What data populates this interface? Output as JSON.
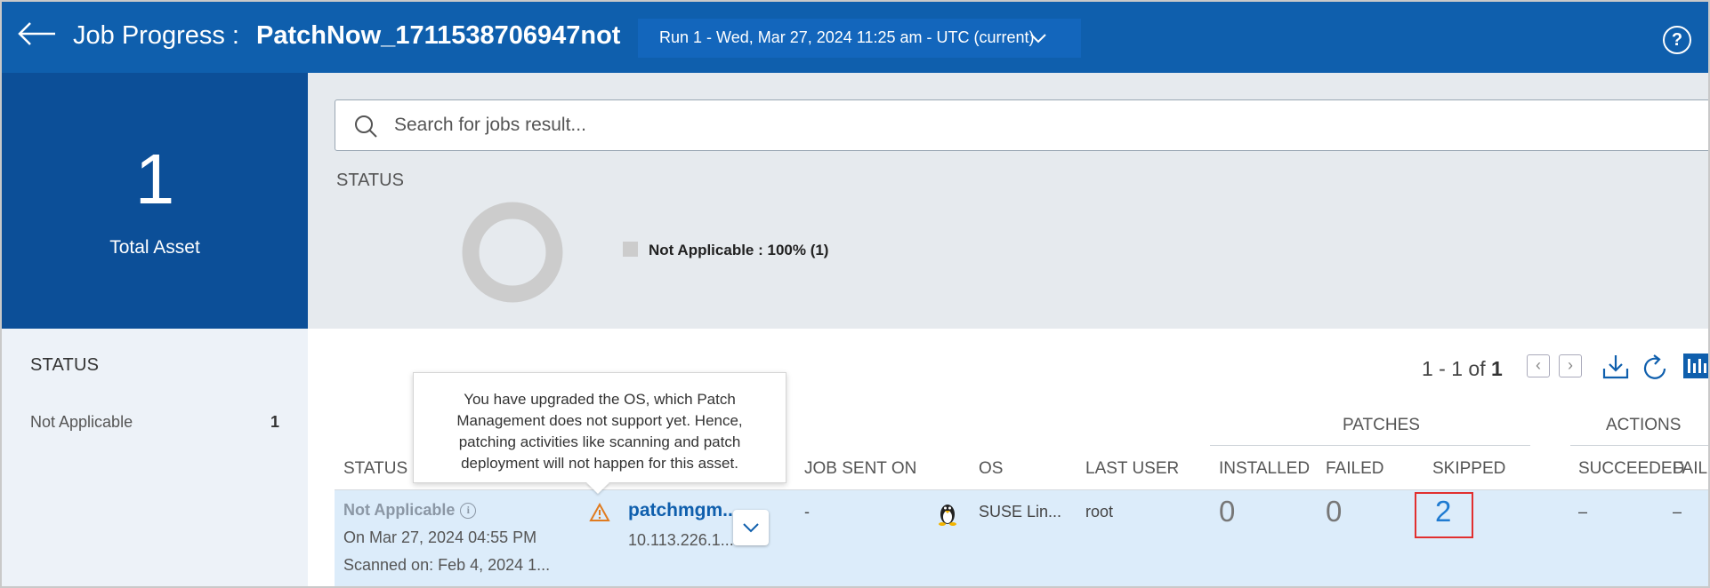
{
  "header": {
    "title_prefix": "Job Progress :",
    "job_name": "PatchNow_1711538706947not",
    "run_selector": "Run 1 - Wed, Mar 27, 2024 11:25 am - UTC (current)",
    "help_label": "?"
  },
  "summary": {
    "total_value": "1",
    "total_label": "Total Asset"
  },
  "left_status": {
    "title": "STATUS",
    "items": [
      {
        "label": "Not Applicable",
        "count": "1"
      }
    ]
  },
  "search": {
    "placeholder": "Search for jobs result..."
  },
  "status_chart": {
    "title": "STATUS",
    "legend_label": "Not Applicable : 100% (1)"
  },
  "chart_data": {
    "type": "pie",
    "slices": [
      {
        "label": "Not Applicable",
        "percent": 100,
        "count": 1,
        "color": "#cccccc"
      }
    ]
  },
  "pager": {
    "range": "1 - 1 of",
    "total": "1",
    "prev": "‹",
    "next": "›"
  },
  "table": {
    "group_patches": "PATCHES",
    "group_actions": "ACTIONS",
    "columns": {
      "status": "STATUS",
      "job_sent_on": "JOB SENT ON",
      "os": "OS",
      "last_user": "LAST USER",
      "installed": "INSTALLED",
      "failed": "FAILED",
      "skipped": "SKIPPED",
      "succeeded": "SUCCEEDED",
      "failed_actions": "FAILED"
    },
    "rows": [
      {
        "status": "Not Applicable",
        "status_date": "On Mar 27, 2024 04:55 PM",
        "scanned_on": "Scanned on: Feb 4, 2024 1...",
        "asset_name": "patchmgm...",
        "asset_ip": "10.113.226.1...",
        "job_sent_on": "-",
        "os": "SUSE Lin...",
        "last_user": "root",
        "installed": "0",
        "failed": "0",
        "skipped": "2",
        "succeeded": "–",
        "failed_actions": "–"
      }
    ]
  },
  "tooltip": {
    "text": "You have upgraded the OS, which Patch Management does not support yet. Hence, patching activities like scanning and patch deployment will not happen for this asset."
  },
  "colors": {
    "header_bg": "#0f5fad",
    "summary_bg": "#0c4f98",
    "row_bg": "#dcecfa",
    "highlight": "#e12f2f"
  }
}
